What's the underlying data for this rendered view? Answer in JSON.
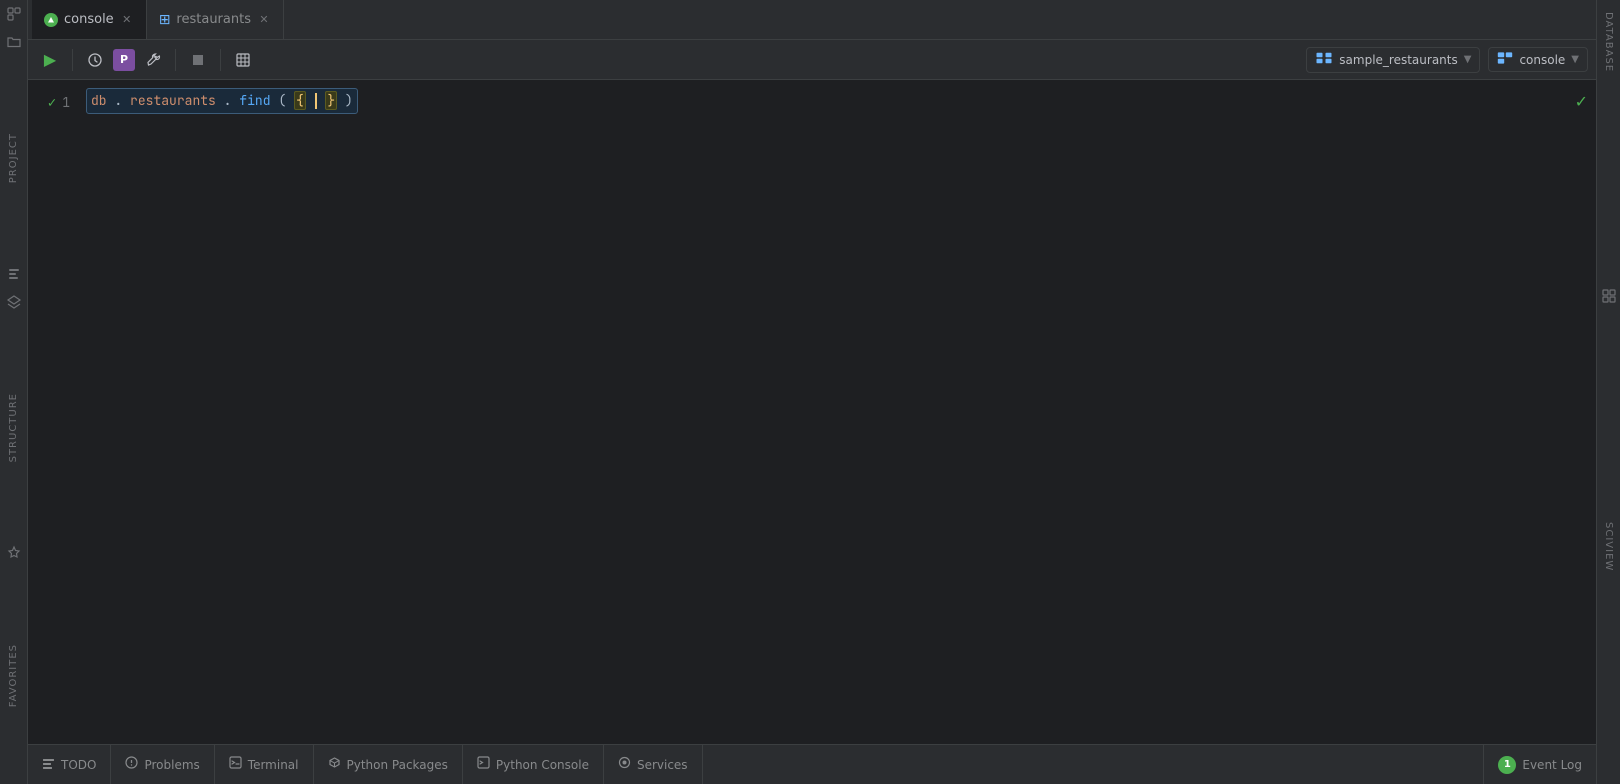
{
  "tabs": [
    {
      "id": "console",
      "label": "console",
      "icon": "green-dot",
      "active": true,
      "closable": true
    },
    {
      "id": "restaurants",
      "label": "restaurants",
      "icon": "grid",
      "active": false,
      "closable": true
    }
  ],
  "toolbar": {
    "run_label": "▶",
    "history_label": "⏱",
    "python_label": "P",
    "wrench_label": "🔧",
    "stop_label": "◼",
    "table_label": "⊞",
    "db_selector": "sample_restaurants",
    "console_selector": "console"
  },
  "editor": {
    "line_number": "1",
    "check_mark": "✓",
    "code_text": "db.restaurants.find({})",
    "code_parts": {
      "object": "db",
      "dot1": ".",
      "collection": "restaurants",
      "dot2": ".",
      "method": "find",
      "open_paren": "(",
      "open_brace": "{",
      "close_brace": "}",
      "close_paren": ")"
    }
  },
  "status_bar": {
    "todo_label": "TODO",
    "problems_label": "Problems",
    "terminal_label": "Terminal",
    "python_packages_label": "Python Packages",
    "python_console_label": "Python Console",
    "services_label": "Services",
    "event_log_label": "Event Log",
    "event_log_count": "1"
  },
  "left_sidebar": {
    "project_label": "Project",
    "structure_label": "Structure",
    "favorites_label": "Favorites"
  },
  "right_sidebar": {
    "database_label": "Database",
    "sciview_label": "SciView"
  }
}
